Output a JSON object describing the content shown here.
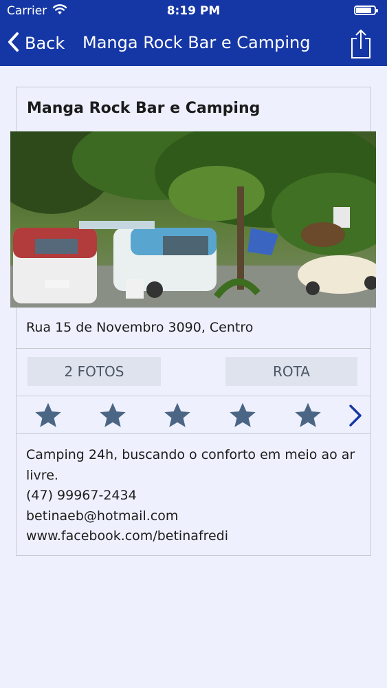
{
  "status_bar": {
    "carrier": "Carrier",
    "time": "8:19 PM",
    "battery_level": 0.85
  },
  "navbar": {
    "back_label": "Back",
    "title": "Manga Rock Bar e Camping",
    "share_icon": "share-icon"
  },
  "place": {
    "name": "Manga Rock Bar e Camping",
    "address": "Rua 15 de Novembro 3090, Centro",
    "photos_label": "2 FOTOS",
    "route_label": "ROTA",
    "rating": {
      "stars_total": 5,
      "star_color": "#4b6584"
    },
    "description": "Camping 24h, buscando o conforto em meio ao ar livre.",
    "phone": "(47) 99967-2434",
    "email": "betinaeb@hotmail.com",
    "website": "www.facebook.com/betinafredi"
  },
  "colors": {
    "header_bg": "#1537a6",
    "page_bg": "#eef0fd",
    "button_bg": "#dfe3ee",
    "chevron": "#1537a6"
  }
}
